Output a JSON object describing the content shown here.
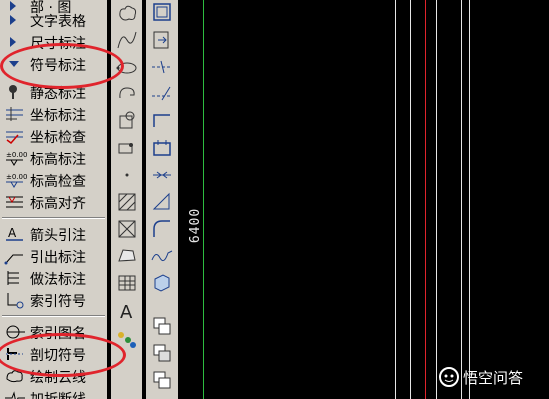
{
  "menu": {
    "items": [
      {
        "label": "部 · 图",
        "kind": "arrow",
        "icon": "triangle-right-icon"
      },
      {
        "label": "文字表格",
        "kind": "arrow",
        "icon": "triangle-right-icon"
      },
      {
        "label": "尺寸标注",
        "kind": "arrow",
        "icon": "triangle-right-icon"
      },
      {
        "label": "符号标注",
        "kind": "arrow-down",
        "icon": "triangle-down-icon"
      },
      {
        "label": "静态标注",
        "kind": "icon",
        "icon": "pushpin-icon"
      },
      {
        "label": "坐标标注",
        "kind": "icon",
        "icon": "coordinate-icon"
      },
      {
        "label": "坐标检查",
        "kind": "icon",
        "icon": "coordinate-check-icon"
      },
      {
        "label": "标高标注",
        "kind": "icon",
        "icon": "elevation-icon"
      },
      {
        "label": "标高检查",
        "kind": "icon",
        "icon": "elevation-check-icon"
      },
      {
        "label": "标高对齐",
        "kind": "icon",
        "icon": "elevation-align-icon"
      },
      {
        "label": "箭头引注",
        "kind": "icon",
        "icon": "arrow-note-icon"
      },
      {
        "label": "引出标注",
        "kind": "icon",
        "icon": "leader-icon"
      },
      {
        "label": "做法标注",
        "kind": "icon",
        "icon": "method-note-icon"
      },
      {
        "label": "索引符号",
        "kind": "icon",
        "icon": "index-symbol-icon"
      },
      {
        "label": "索引图名",
        "kind": "icon",
        "icon": "index-name-icon"
      },
      {
        "label": "剖切符号",
        "kind": "icon",
        "icon": "section-symbol-icon"
      },
      {
        "label": "绘制云线",
        "kind": "icon",
        "icon": "cloud-line-icon"
      },
      {
        "label": "加折断线",
        "kind": "icon",
        "icon": "break-line-icon"
      }
    ]
  },
  "toolbar1": {
    "icons": [
      "cloud-icon",
      "spline-icon",
      "ellipse-arc-icon",
      "revision-icon",
      "block-icon",
      "hatch-icon",
      "dot-icon",
      "box-hatch-icon",
      "box-pattern-icon",
      "polygon-icon",
      "table-icon",
      "text-a-icon",
      "multi-point-icon"
    ],
    "text_a": "A"
  },
  "toolbar2": {
    "icons": [
      "window-icon",
      "move-icon",
      "dashed-line-icon",
      "dashed-angle-icon",
      "line-end-icon",
      "bracket-icon",
      "dimension-icon",
      "slope-icon",
      "arc-icon",
      "wave-icon",
      "solid-icon",
      "copy-icon",
      "layer-icon",
      "stack-icon",
      "stack2-icon"
    ]
  },
  "canvas": {
    "dimension_text": "6400",
    "line_colors": {
      "green": "#2dbb3f",
      "white": "#e6e6e6",
      "red": "#e0242c"
    }
  },
  "annotations": {
    "highlight_color": "#e0242c"
  },
  "watermark": {
    "text": "悟空问答",
    "icon": "wukong-logo-icon"
  }
}
